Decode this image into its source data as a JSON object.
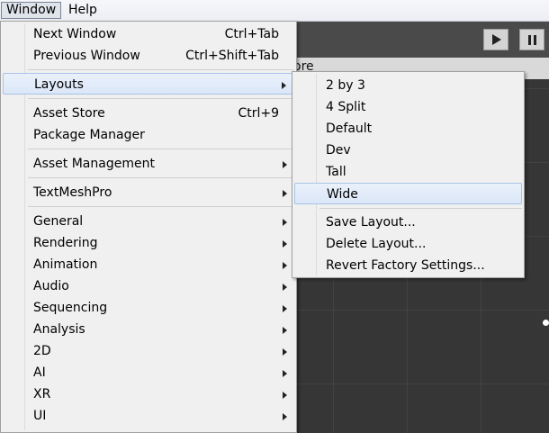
{
  "menubar": {
    "window": "Window",
    "help": "Help"
  },
  "background": {
    "tab_text": "ore"
  },
  "window_menu": {
    "items": [
      {
        "label": "Next Window",
        "shortcut": "Ctrl+Tab"
      },
      {
        "label": "Previous Window",
        "shortcut": "Ctrl+Shift+Tab"
      },
      {
        "label": "Layouts",
        "submenu": true,
        "highlighted": true
      },
      {
        "label": "Asset Store",
        "shortcut": "Ctrl+9"
      },
      {
        "label": "Package Manager"
      },
      {
        "label": "Asset Management",
        "submenu": true
      },
      {
        "label": "TextMeshPro",
        "submenu": true
      },
      {
        "label": "General",
        "submenu": true
      },
      {
        "label": "Rendering",
        "submenu": true
      },
      {
        "label": "Animation",
        "submenu": true
      },
      {
        "label": "Audio",
        "submenu": true
      },
      {
        "label": "Sequencing",
        "submenu": true
      },
      {
        "label": "Analysis",
        "submenu": true
      },
      {
        "label": "2D",
        "submenu": true
      },
      {
        "label": "AI",
        "submenu": true
      },
      {
        "label": "XR",
        "submenu": true
      },
      {
        "label": "UI",
        "submenu": true
      }
    ]
  },
  "layouts_submenu": {
    "items": [
      {
        "label": "2 by 3"
      },
      {
        "label": "4 Split"
      },
      {
        "label": "Default"
      },
      {
        "label": "Dev"
      },
      {
        "label": "Tall"
      },
      {
        "label": "Wide",
        "highlighted": true
      },
      {
        "label": "Save Layout..."
      },
      {
        "label": "Delete Layout..."
      },
      {
        "label": "Revert Factory Settings..."
      }
    ]
  },
  "colors": {
    "highlight": "#dbe7f8",
    "menu_bg": "#f0f0f0",
    "editor_bg": "#383838"
  }
}
